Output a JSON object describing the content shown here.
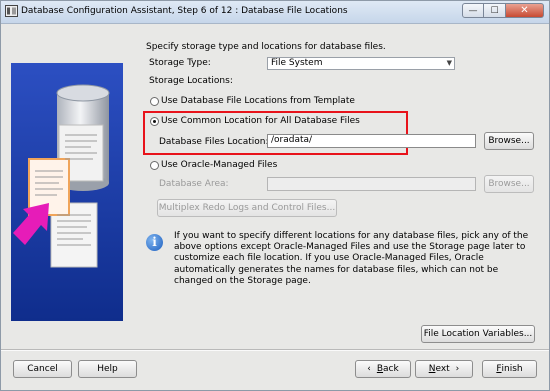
{
  "window": {
    "title": "Database Configuration Assistant, Step 6 of 12 : Database File Locations",
    "controls": {
      "minimize": "—",
      "maximize": "☐",
      "close": "✕"
    }
  },
  "main": {
    "intro": "Specify storage type and locations for database files.",
    "storage_type_label": "Storage Type:",
    "storage_type_value": "File System",
    "storage_locations_label": "Storage Locations:",
    "option_template": "Use Database File Locations from Template",
    "option_common": "Use Common Location for All Database Files",
    "db_files_location_label": "Database Files Location:",
    "db_files_location_value": "/oradata/",
    "browse": "Browse...",
    "option_omf": "Use Oracle-Managed Files",
    "db_area_label": "Database Area:",
    "db_area_value": "",
    "multiplex_button": "Multiplex Redo Logs and Control Files...",
    "info": "If you want to specify different locations for any database files, pick any of the above options except Oracle-Managed Files and use the Storage page later to customize each file location. If you use Oracle-Managed Files, Oracle automatically generates the names for database files, which can not be changed on the Storage page.",
    "file_location_variables": "File Location Variables..."
  },
  "footer": {
    "cancel": "Cancel",
    "help": "Help",
    "back_prefix": "B",
    "back_rest": "ack",
    "next_prefix": "N",
    "next_rest": "ext",
    "finish_prefix": "F",
    "finish_rest": "inish"
  },
  "colors": {
    "highlight": "#e8131b",
    "side_panel": "#1a3fa8",
    "info_icon": "#1d5fbf"
  },
  "icons": [
    "oracle-dca-icon",
    "database-cylinder-icon",
    "documents-icon",
    "pink-arrow-icon",
    "info-icon",
    "back-arrow-icon",
    "next-arrow-icon"
  ]
}
